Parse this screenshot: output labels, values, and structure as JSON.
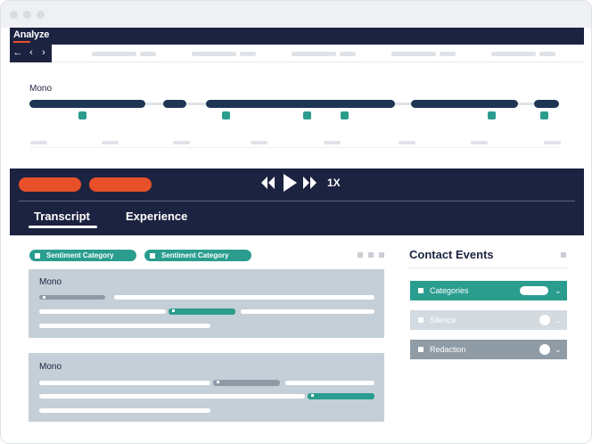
{
  "app": {
    "title": "Analyze"
  },
  "nav": {
    "back_glyph": "←",
    "prev_glyph": "‹",
    "next_glyph": "›"
  },
  "timeline": {
    "title": "Mono"
  },
  "player": {
    "rewind_glyph": "⏪",
    "play_glyph": "▶",
    "forward_glyph": "⏩",
    "speed": "1X"
  },
  "tabs": [
    {
      "label": "Transcript",
      "active": true
    },
    {
      "label": "Experience",
      "active": false
    }
  ],
  "filters": [
    {
      "label": "Sentiment Category"
    },
    {
      "label": "Sentiment Category"
    }
  ],
  "transcript": [
    {
      "speaker": "Mono"
    },
    {
      "speaker": "Mono"
    }
  ],
  "contact_events": {
    "title": "Contact Events",
    "items": [
      {
        "label": "Categories",
        "enabled": true,
        "color": "#2a9d8f"
      },
      {
        "label": "Silence",
        "enabled": false,
        "color": "#d3dbe1"
      },
      {
        "label": "Redaction",
        "enabled": false,
        "color": "#8f9ba5"
      }
    ],
    "chevron_glyph": "⌄"
  },
  "colors": {
    "navy": "#1c2340",
    "accent_orange": "#e8502a",
    "teal": "#2a9d8f",
    "card_grey": "#c4cfd7"
  },
  "icons": [
    "back-arrow-icon",
    "chevron-left-icon",
    "chevron-right-icon",
    "rewind-icon",
    "play-icon",
    "fast-forward-icon",
    "chevron-down-icon"
  ]
}
